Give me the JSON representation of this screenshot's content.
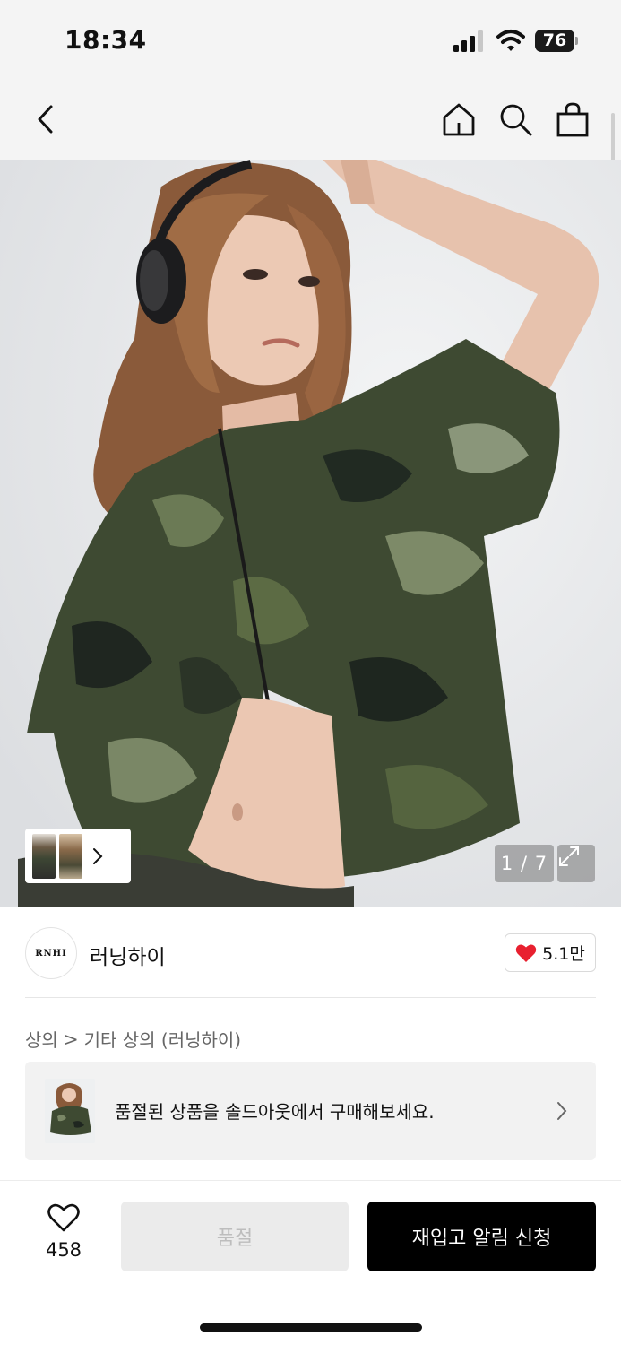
{
  "status_bar": {
    "time": "18:34",
    "battery": "76"
  },
  "nav": {
    "back_icon": "chevron-left-icon",
    "home_icon": "home-icon",
    "search_icon": "search-icon",
    "bag_icon": "shopping-bag-icon"
  },
  "gallery": {
    "counter": "1 / 7",
    "expand_icon": "expand-icon",
    "thumb_chevron_icon": "chevron-right-icon"
  },
  "brand": {
    "logo_text": "RNHI",
    "name": "러닝하이",
    "like_count": "5.1만",
    "like_icon": "heart-filled-icon",
    "like_color": "#e8202f"
  },
  "breadcrumb": {
    "level1": "상의",
    "separator": ">",
    "level2": "기타 상의 (러닝하이)"
  },
  "soldout_banner": {
    "text": "품절된 상품을 솔드아웃에서 구매해보세요.",
    "chevron_icon": "chevron-right-icon"
  },
  "bottom_bar": {
    "wish_icon": "heart-outline-icon",
    "wish_count": "458",
    "soldout_label": "품절",
    "restock_label": "재입고 알림 신청"
  }
}
